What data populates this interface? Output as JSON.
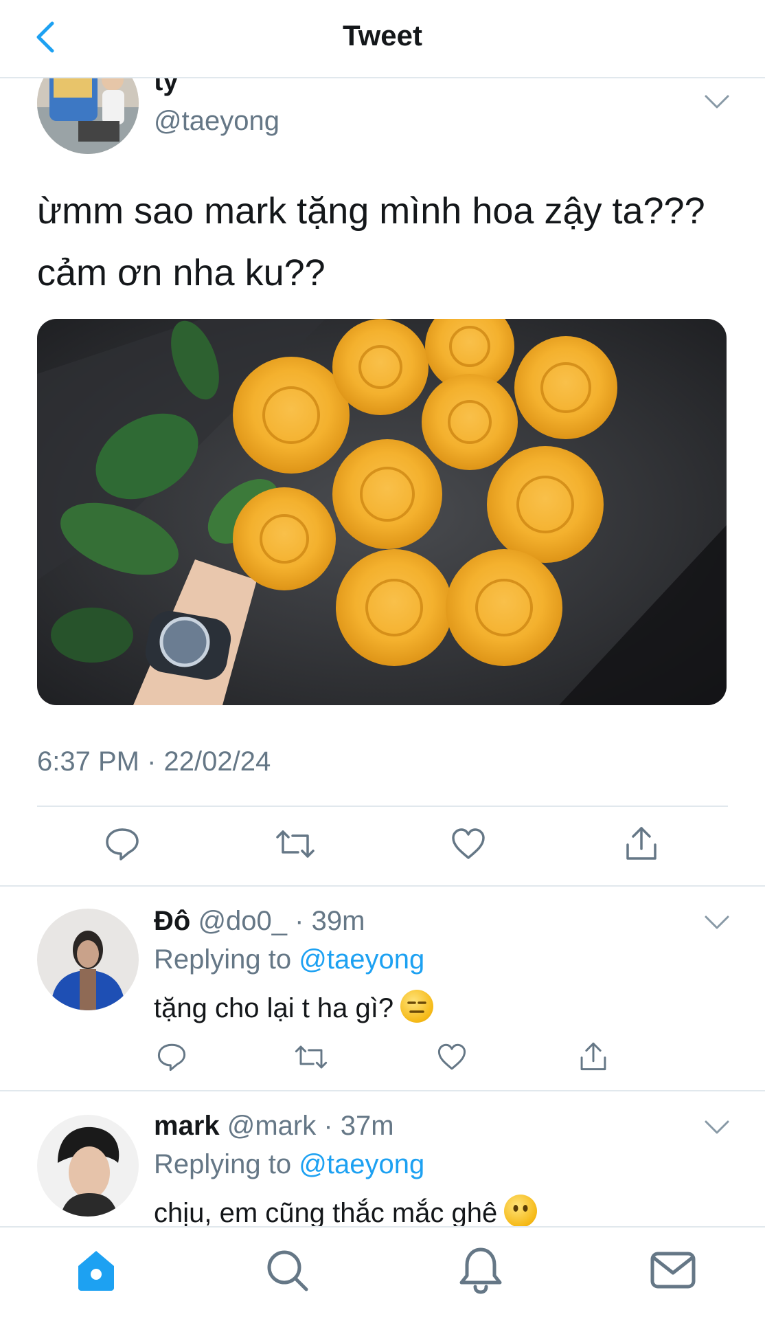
{
  "header": {
    "title": "Tweet"
  },
  "tweet": {
    "author_name": "ty",
    "author_handle": "@taeyong",
    "text": "ừmm sao mark tặng mình hoa zậy ta??? cảm ơn nha ku??",
    "timestamp": "6:37 PM · 22/02/24"
  },
  "replies": [
    {
      "name": "Đô",
      "handle": "@do0_",
      "time": "· 39m",
      "replying_label": "Replying to",
      "replying_to": "@taeyong",
      "text": "tặng cho lại t ha gì?",
      "emoji": "expressionless-face"
    },
    {
      "name": "mark",
      "handle": "@mark",
      "time": "· 37m",
      "replying_label": "Replying to",
      "replying_to": "@taeyong",
      "text": "chịu, em cũng thắc mắc ghê",
      "emoji": "face-without-mouth"
    }
  ],
  "tabbar": [
    "home-icon",
    "search-icon",
    "notifications-icon",
    "messages-icon"
  ],
  "colors": {
    "accent": "#1da1f2",
    "muted": "#657786",
    "divider": "#e1e8ed",
    "rose": "#f4b12e"
  }
}
